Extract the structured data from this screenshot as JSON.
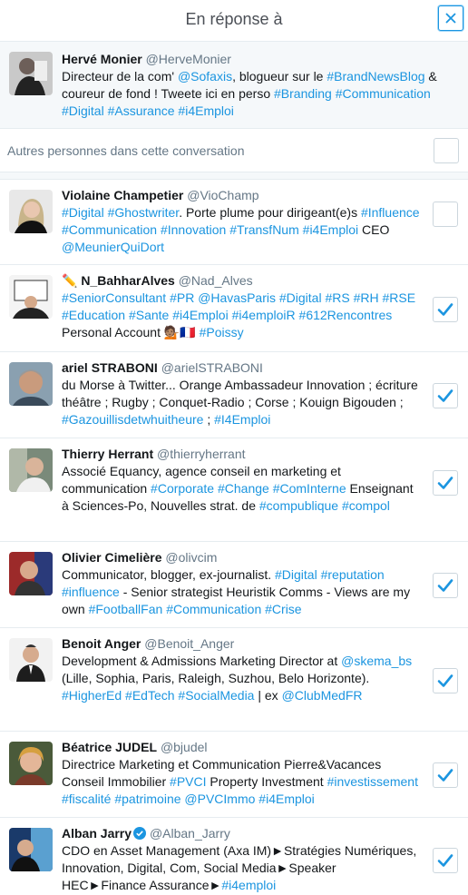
{
  "header": {
    "title": "En réponse à"
  },
  "author": {
    "name": "Hervé Monier",
    "handle": "@HerveMonier",
    "bio": [
      {
        "t": "Directeur de la com' "
      },
      {
        "t": "@Sofaxis",
        "h": true
      },
      {
        "t": ", blogueur sur le "
      },
      {
        "t": "#BrandNewsBlog",
        "h": true
      },
      {
        "t": " & coureur de fond ! Tweete ici en perso "
      },
      {
        "t": "#Branding",
        "h": true
      },
      {
        "t": " "
      },
      {
        "t": "#Communication",
        "h": true
      },
      {
        "t": " "
      },
      {
        "t": "#Digital",
        "h": true
      },
      {
        "t": " "
      },
      {
        "t": "#Assurance",
        "h": true
      },
      {
        "t": " "
      },
      {
        "t": "#i4Emploi",
        "h": true
      }
    ]
  },
  "others": {
    "label": "Autres personnes dans cette conversation",
    "checked": false
  },
  "users": [
    {
      "name": "Violaine Champetier",
      "handle": "@VioChamp",
      "checked": false,
      "verified": false,
      "bio": [
        {
          "t": "#Digital",
          "h": true
        },
        {
          "t": " "
        },
        {
          "t": "#Ghostwriter",
          "h": true
        },
        {
          "t": ". Porte plume pour dirigeant(e)s "
        },
        {
          "t": "#Influence",
          "h": true
        },
        {
          "t": " "
        },
        {
          "t": "#Communication",
          "h": true
        },
        {
          "t": " "
        },
        {
          "t": "#Innovation",
          "h": true
        },
        {
          "t": " "
        },
        {
          "t": "#TransfNum",
          "h": true
        },
        {
          "t": " "
        },
        {
          "t": "#i4Emploi",
          "h": true
        },
        {
          "t": " CEO "
        },
        {
          "t": "@MeunierQuiDort",
          "h": true
        }
      ]
    },
    {
      "name": "✏️ N_BahharAlves",
      "handle": "@Nad_Alves",
      "checked": true,
      "verified": false,
      "bio": [
        {
          "t": "#SeniorConsultant",
          "h": true
        },
        {
          "t": " "
        },
        {
          "t": "#PR",
          "h": true
        },
        {
          "t": " "
        },
        {
          "t": "@HavasParis",
          "h": true
        },
        {
          "t": " "
        },
        {
          "t": "#Digital",
          "h": true
        },
        {
          "t": " "
        },
        {
          "t": "#RS",
          "h": true
        },
        {
          "t": " "
        },
        {
          "t": "#RH",
          "h": true
        },
        {
          "t": " "
        },
        {
          "t": "#RSE",
          "h": true
        },
        {
          "t": " "
        },
        {
          "t": "#Education",
          "h": true
        },
        {
          "t": " "
        },
        {
          "t": "#Sante",
          "h": true
        },
        {
          "t": " "
        },
        {
          "t": "#i4Emploi",
          "h": true
        },
        {
          "t": " "
        },
        {
          "t": "#i4emploiR",
          "h": true
        },
        {
          "t": " "
        },
        {
          "t": "#612Rencontres",
          "h": true
        },
        {
          "t": " Personal Account 💁🏽🇫🇷 "
        },
        {
          "t": "#Poissy",
          "h": true
        }
      ]
    },
    {
      "name": "ariel STRABONI",
      "handle": "@arielSTRABONI",
      "checked": true,
      "verified": false,
      "bio": [
        {
          "t": "du Morse à Twitter... Orange Ambassadeur Innovation ; écriture théâtre ; Rugby ; Conquet-Radio ; Corse ; Kouign Bigouden ; "
        },
        {
          "t": "#Gazouillisdetwhuitheure",
          "h": true
        },
        {
          "t": " ; "
        },
        {
          "t": "#I4Emploi",
          "h": true
        }
      ]
    },
    {
      "name": "Thierry Herrant",
      "handle": "@thierryherrant",
      "checked": true,
      "verified": false,
      "bio": [
        {
          "t": "Associé Equancy, agence conseil en marketing et communication "
        },
        {
          "t": "#Corporate",
          "h": true
        },
        {
          "t": " "
        },
        {
          "t": "#Change",
          "h": true
        },
        {
          "t": " "
        },
        {
          "t": "#ComInterne",
          "h": true
        },
        {
          "t": " Enseignant à Sciences-Po, Nouvelles strat. de "
        },
        {
          "t": "#compublique",
          "h": true
        },
        {
          "t": " "
        },
        {
          "t": "#compol",
          "h": true
        }
      ]
    },
    {
      "name": "Olivier Cimelière",
      "handle": "@olivcim",
      "checked": true,
      "verified": false,
      "bio": [
        {
          "t": "Communicator, blogger, ex-journalist. "
        },
        {
          "t": "#Digital",
          "h": true
        },
        {
          "t": " "
        },
        {
          "t": "#reputation",
          "h": true
        },
        {
          "t": " "
        },
        {
          "t": "#influence",
          "h": true
        },
        {
          "t": " - Senior strategist Heuristik Comms - Views are my own "
        },
        {
          "t": "#FootballFan",
          "h": true
        },
        {
          "t": " "
        },
        {
          "t": "#Communication",
          "h": true
        },
        {
          "t": " "
        },
        {
          "t": "#Crise",
          "h": true
        }
      ]
    },
    {
      "name": "Benoit Anger",
      "handle": "@Benoit_Anger",
      "checked": true,
      "verified": false,
      "bio": [
        {
          "t": "Development & Admissions Marketing Director at "
        },
        {
          "t": "@skema_bs",
          "h": true
        },
        {
          "t": " (Lille, Sophia, Paris, Raleigh, Suzhou, Belo Horizonte). "
        },
        {
          "t": "#HigherEd",
          "h": true
        },
        {
          "t": " "
        },
        {
          "t": "#EdTech",
          "h": true
        },
        {
          "t": " "
        },
        {
          "t": "#SocialMedia",
          "h": true
        },
        {
          "t": " | ex "
        },
        {
          "t": "@ClubMedFR",
          "h": true
        }
      ]
    },
    {
      "name": "Béatrice JUDEL",
      "handle": "@bjudel",
      "checked": true,
      "verified": false,
      "bio": [
        {
          "t": "Directrice Marketing et Communication Pierre&Vacances Conseil Immobilier "
        },
        {
          "t": "#PVCI",
          "h": true
        },
        {
          "t": " Property Investment "
        },
        {
          "t": "#investissement",
          "h": true
        },
        {
          "t": " "
        },
        {
          "t": "#fiscalité",
          "h": true
        },
        {
          "t": " "
        },
        {
          "t": "#patrimoine",
          "h": true
        },
        {
          "t": " "
        },
        {
          "t": "@PVCImmo",
          "h": true
        },
        {
          "t": " "
        },
        {
          "t": "#i4Emploi",
          "h": true
        }
      ]
    },
    {
      "name": "Alban Jarry",
      "handle": "@Alban_Jarry",
      "checked": true,
      "verified": true,
      "bio": [
        {
          "t": "CDO en Asset Management (Axa IM)►Stratégies Numériques, Innovation, Digital, Com, Social Media►Speaker HEC►Finance Assurance►"
        },
        {
          "t": "#i4emploi",
          "h": true
        }
      ]
    }
  ],
  "colors": {
    "link": "#1b95e0",
    "check": "#1b95e0",
    "border": "#e6ecf0"
  }
}
